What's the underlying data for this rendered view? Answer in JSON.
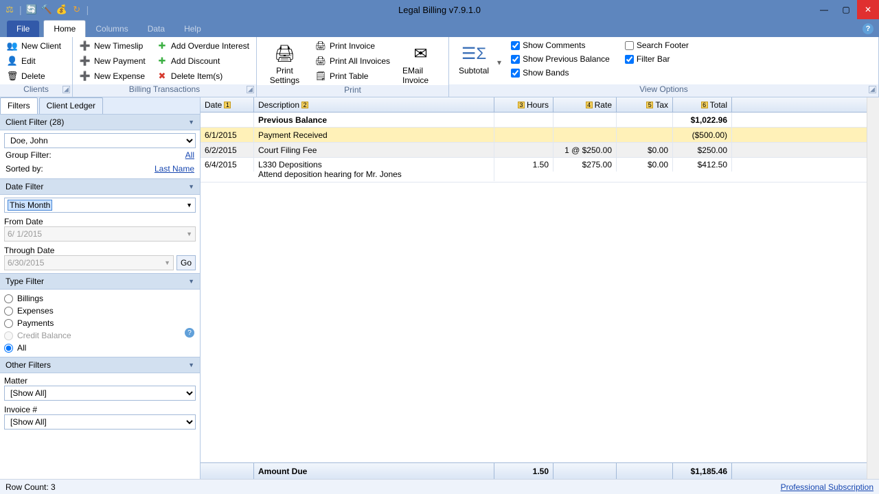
{
  "title": "Legal Billing v7.9.1.0",
  "menu": {
    "file": "File",
    "home": "Home",
    "columns": "Columns",
    "data": "Data",
    "help": "Help"
  },
  "ribbon": {
    "clients": {
      "label": "Clients",
      "new_client": "New Client",
      "edit": "Edit",
      "delete": "Delete"
    },
    "billing": {
      "label": "Billing Transactions",
      "new_timeslip": "New Timeslip",
      "new_payment": "New Payment",
      "new_expense": "New Expense",
      "add_overdue": "Add Overdue Interest",
      "add_discount": "Add Discount",
      "delete_items": "Delete Item(s)"
    },
    "print": {
      "label": "Print",
      "settings": "Print Settings",
      "print_invoice": "Print Invoice",
      "print_all": "Print All Invoices",
      "print_table": "Print Table",
      "email": "EMail Invoice"
    },
    "subtotal": "Subtotal",
    "view": {
      "label": "View Options",
      "show_comments": "Show Comments",
      "show_prev_balance": "Show Previous Balance",
      "show_bands": "Show Bands",
      "search_footer": "Search Footer",
      "filter_bar": "Filter Bar"
    }
  },
  "tabs": {
    "filters": "Filters",
    "ledger": "Client Ledger"
  },
  "client_filter": {
    "header": "Client Filter (28)",
    "selected": "Doe, John",
    "group_label": "Group Filter:",
    "group_link": "All",
    "sorted_label": "Sorted by:",
    "sorted_link": "Last Name"
  },
  "date_filter": {
    "header": "Date Filter",
    "range": "This Month",
    "from_label": "From Date",
    "from_value": "6/  1/2015",
    "through_label": "Through Date",
    "through_value": "6/30/2015",
    "go": "Go"
  },
  "type_filter": {
    "header": "Type Filter",
    "billings": "Billings",
    "expenses": "Expenses",
    "payments": "Payments",
    "credit": "Credit Balance",
    "all": "All"
  },
  "other_filters": {
    "header": "Other Filters",
    "matter_label": "Matter",
    "matter_value": "[Show All]",
    "invoice_label": "Invoice #",
    "invoice_value": "[Show All]"
  },
  "grid": {
    "headers": {
      "date": "Date",
      "desc": "Description",
      "hours": "Hours",
      "rate": "Rate",
      "tax": "Tax",
      "total": "Total"
    },
    "prev_balance_label": "Previous Balance",
    "prev_balance_total": "$1,022.96",
    "rows": [
      {
        "date": "6/1/2015",
        "desc": "Payment Received",
        "hours": "",
        "rate": "",
        "tax": "",
        "total": "($500.00)",
        "payment": true
      },
      {
        "date": "6/2/2015",
        "desc": "Court Filing Fee",
        "hours": "",
        "rate": "1 @ $250.00",
        "tax": "$0.00",
        "total": "$250.00",
        "alt": true
      },
      {
        "date": "6/4/2015",
        "desc": "L330 Depositions",
        "desc2": "Attend deposition hearing for Mr. Jones",
        "hours": "1.50",
        "rate": "$275.00",
        "tax": "$0.00",
        "total": "$412.50"
      }
    ],
    "footer": {
      "label": "Amount Due",
      "hours": "1.50",
      "total": "$1,185.46"
    }
  },
  "status": {
    "row_count": "Row Count:  3",
    "subscription": "Professional Subscription"
  }
}
